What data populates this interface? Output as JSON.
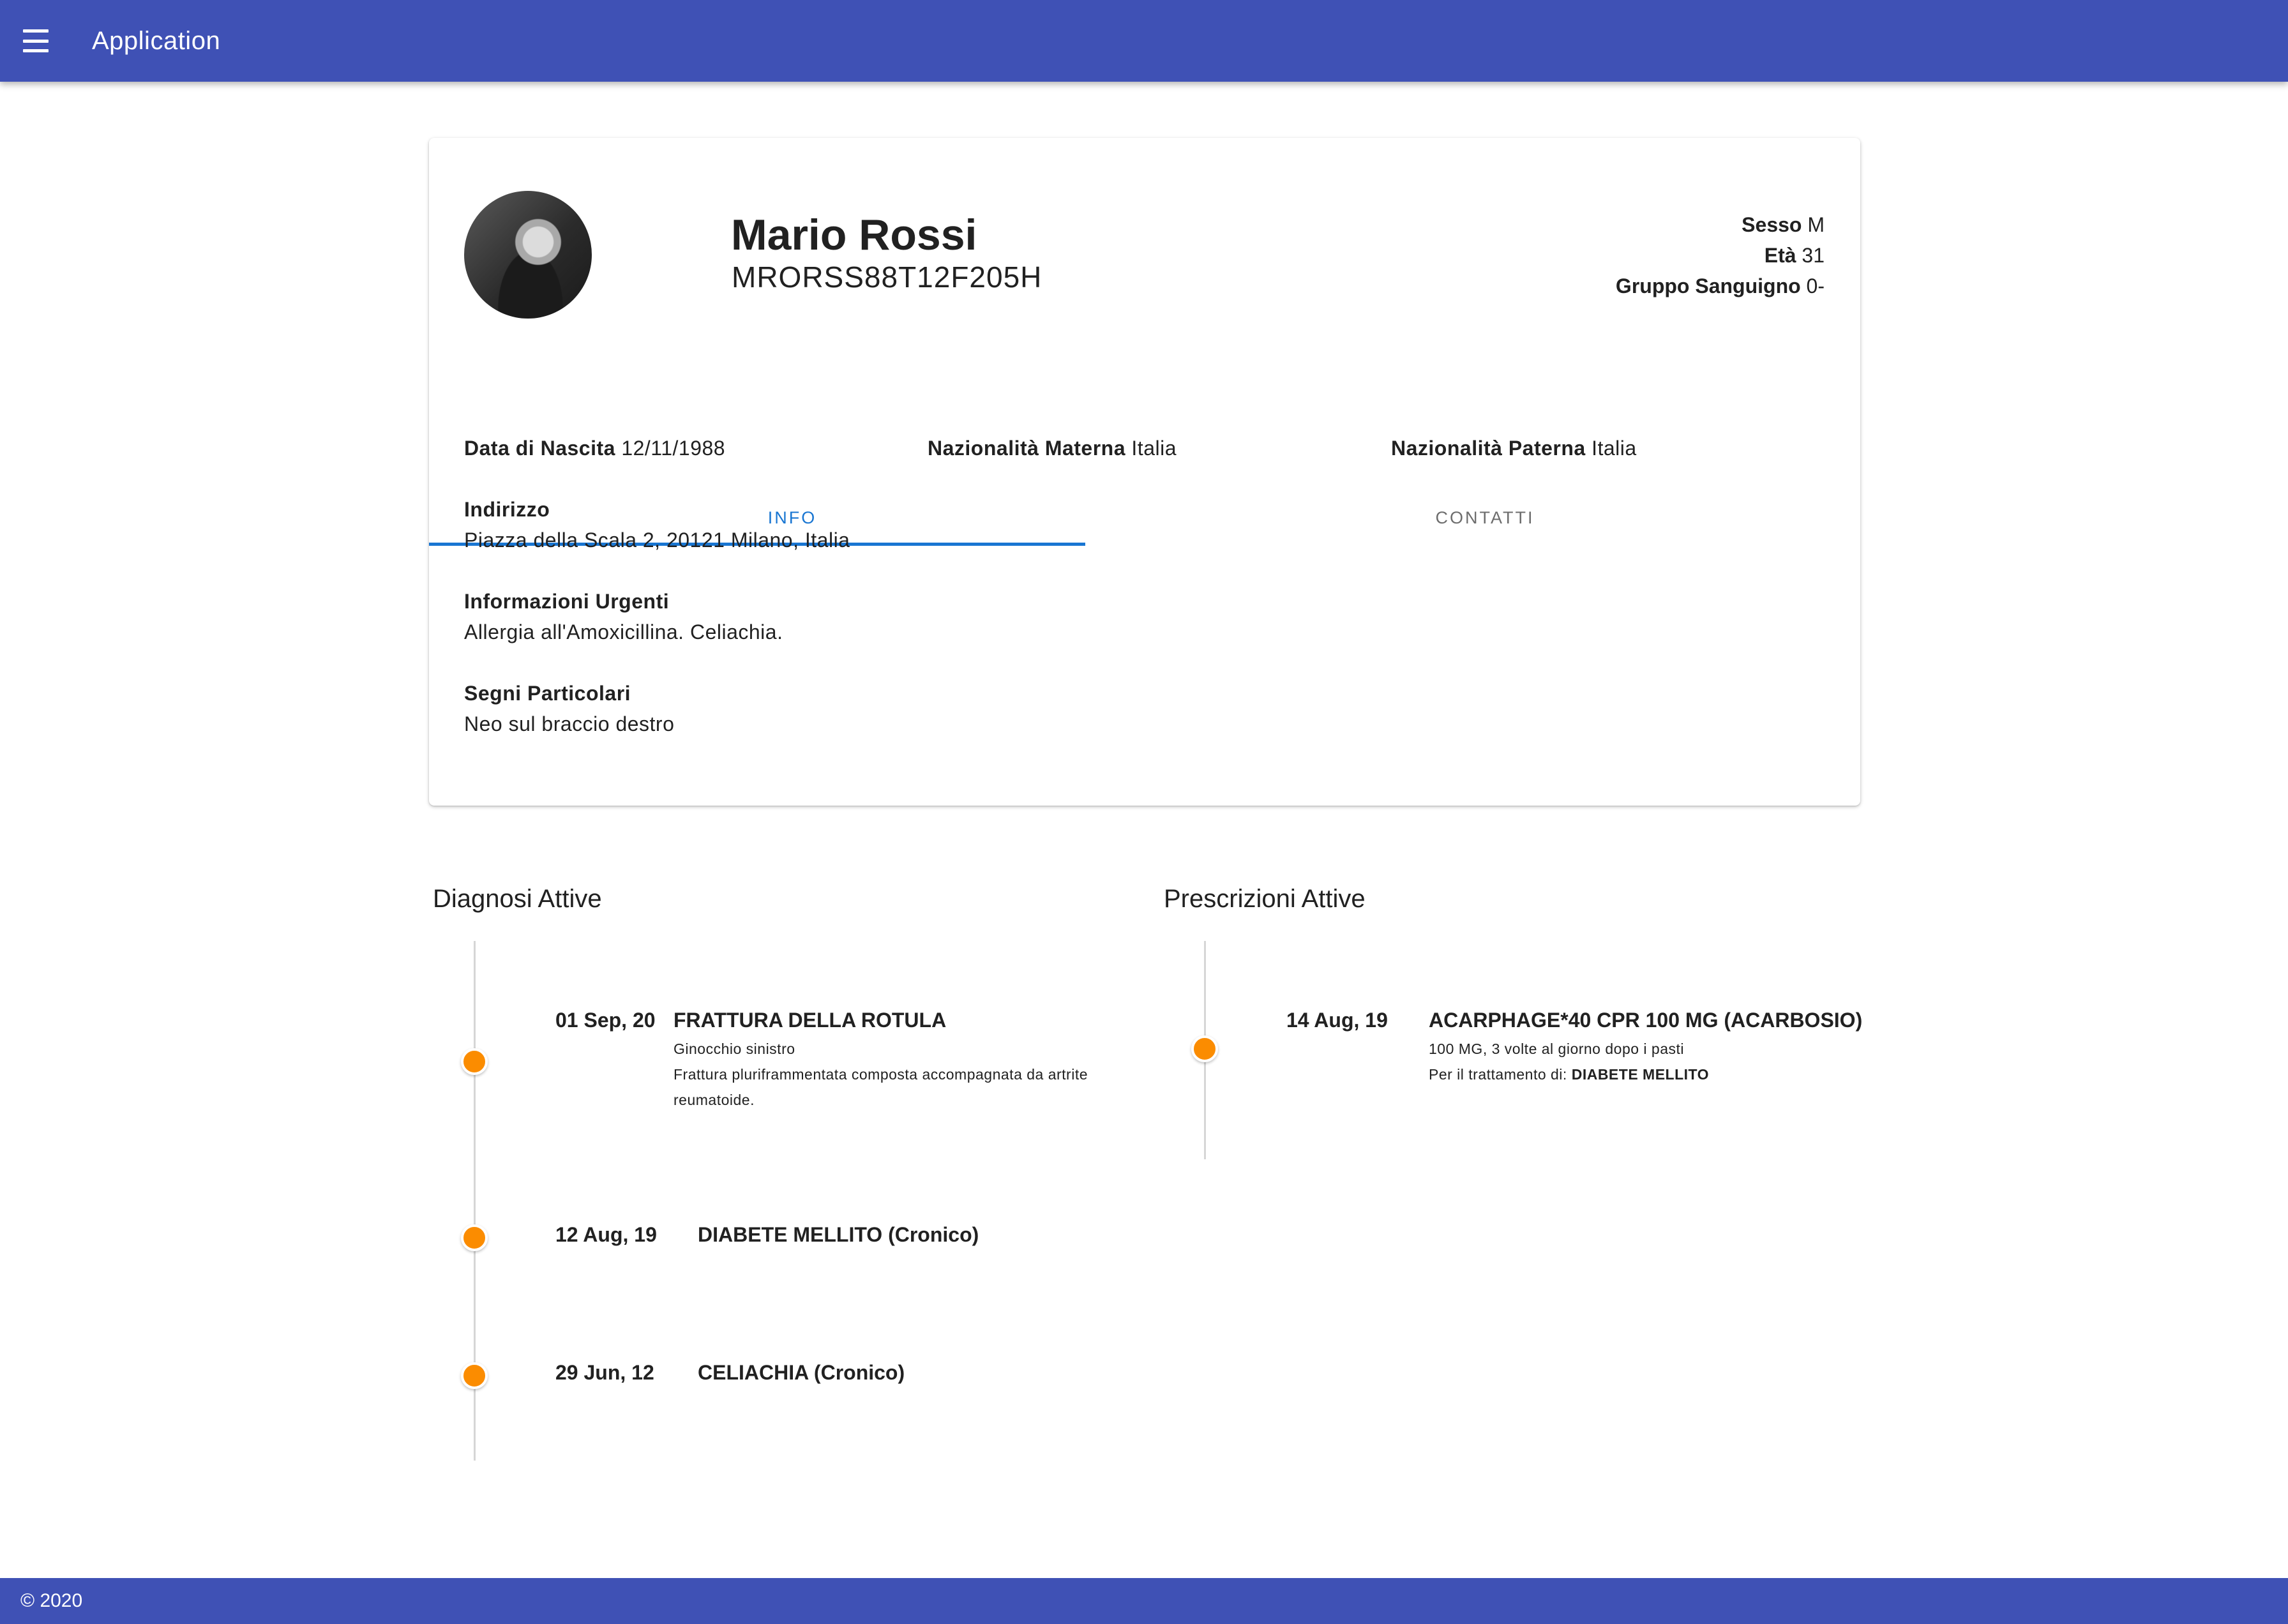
{
  "appbar": {
    "menu_icon": "hamburger-menu-icon",
    "title": "Application",
    "color": "#3f51b5"
  },
  "patient": {
    "name": "Mario Rossi",
    "codice_fiscale": "MRORSS88T12F205H",
    "sesso_label": "Sesso",
    "sesso": "M",
    "eta_label": "Età",
    "eta": "31",
    "gruppo_label": "Gruppo Sanguigno",
    "gruppo": "0-"
  },
  "tabs": {
    "info": "INFO",
    "contatti": "CONTATTI",
    "active": "INFO",
    "accent": "#1976d2"
  },
  "info": {
    "data_nascita_label": "Data di Nascita",
    "data_nascita": "12/11/1988",
    "naz_materna_label": "Nazionalità Materna",
    "naz_materna": "Italia",
    "naz_paterna_label": "Nazionalità Paterna",
    "naz_paterna": "Italia",
    "indirizzo_label": "Indirizzo",
    "indirizzo": "Piazza della Scala 2, 20121 Milano, Italia",
    "urgenti_label": "Informazioni Urgenti",
    "urgenti": "Allergia all'Amoxicillina. Celiachia.",
    "segni_label": "Segni Particolari",
    "segni": "Neo sul braccio destro"
  },
  "diagnosi": {
    "title": "Diagnosi Attive",
    "dot_color": "#fb8c00",
    "items": [
      {
        "date": "01 Sep, 20",
        "title": "FRATTURA DELLA ROTULA",
        "line1": "Ginocchio sinistro",
        "line2": "Frattura pluriframmentata composta accompagnata da artrite",
        "line3": "reumatoide."
      },
      {
        "date": "12 Aug, 19",
        "title": "DIABETE MELLITO (Cronico)"
      },
      {
        "date": "29 Jun, 12",
        "title": "CELIACHIA (Cronico)"
      }
    ]
  },
  "prescrizioni": {
    "title": "Prescrizioni Attive",
    "items": [
      {
        "date": "14 Aug, 19",
        "title": "ACARPHAGE*40 CPR 100 MG (ACARBOSIO)",
        "dosage": "100 MG, 3 volte al giorno dopo i pasti",
        "treatment_label": "Per il trattamento di:",
        "treatment": "DIABETE MELLITO"
      }
    ]
  },
  "footer": {
    "text": "© 2020"
  }
}
